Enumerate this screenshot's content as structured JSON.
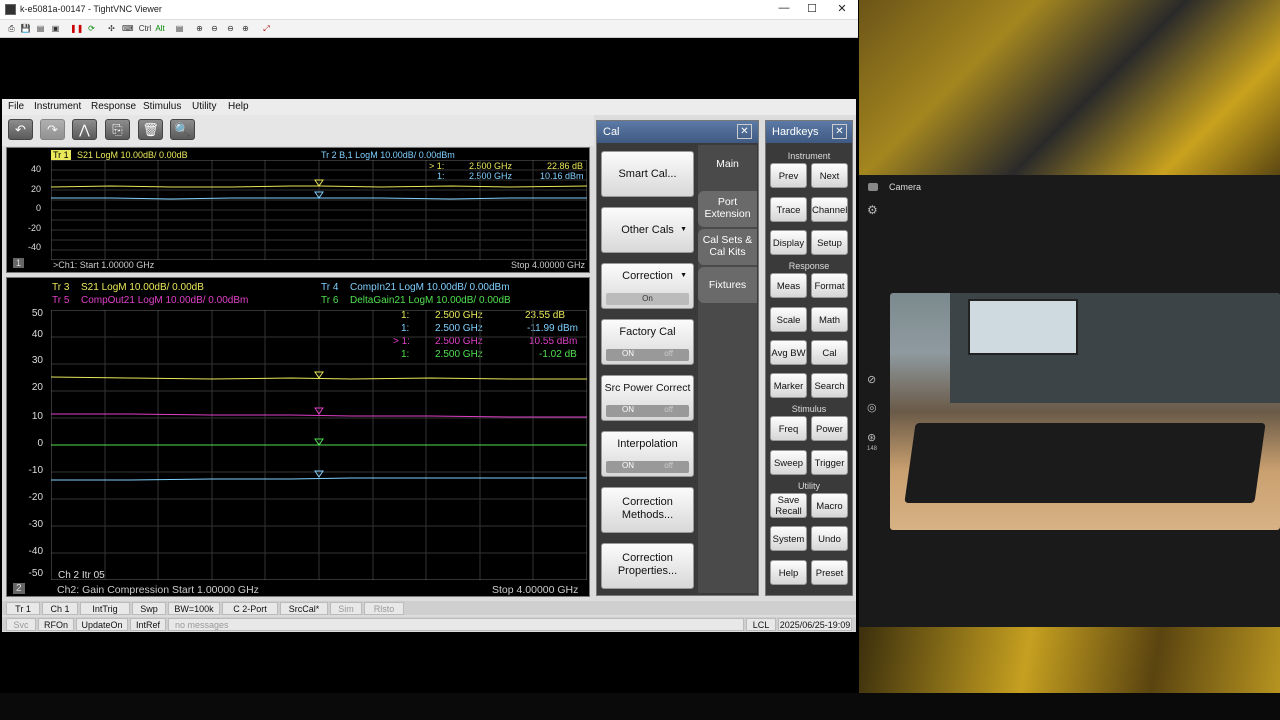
{
  "vnc": {
    "title": "k-e5081a-00147 - TightVNC Viewer",
    "minimize": "—",
    "maximize": "☐",
    "close": "✕",
    "toolbar_icons": [
      "⎙",
      "💾",
      "▤",
      "▣",
      "❚❚",
      "⟳",
      "✣",
      "⌨",
      "Ctrl",
      "Alt",
      "▤",
      "⊕",
      "⊖",
      "⊖",
      "⊕",
      "⤢"
    ]
  },
  "menu": [
    "File",
    "Instrument",
    "Response",
    "Stimulus",
    "Utility",
    "Help"
  ],
  "appbar_icons": [
    "↶",
    "↷",
    "⋀",
    "⎘",
    "🗑",
    "🔍"
  ],
  "window1": {
    "number": "1",
    "trace1": "S21 LogM 10.00dB/ 0.00dB",
    "trace1_id": "Tr 1",
    "trace2": "Tr 2  B,1 LogM 10.00dB/ 0.00dBm",
    "markers": [
      {
        "id": "> 1:",
        "freq": "2.500  GHz",
        "val": "22.86 dB",
        "color": "#e8e85a"
      },
      {
        "id": "1:",
        "freq": "2.500  GHz",
        "val": "10.16 dBm",
        "color": "#7fd0ff"
      }
    ],
    "yticks": [
      "40",
      "20",
      "0",
      "-20",
      "-40"
    ],
    "footer_left": ">Ch1: Start  1.00000 GHz",
    "footer_right": "Stop  4.00000 GHz"
  },
  "window2": {
    "number": "2",
    "traces": [
      {
        "id": "Tr 3",
        "label": "S21 LogM 10.00dB/ 0.00dB",
        "color": "#e8e85a"
      },
      {
        "id": "Tr 4",
        "label": "CompIn21 LogM 10.00dB/ 0.00dBm",
        "color": "#7fd0ff"
      },
      {
        "id": "Tr 5",
        "label": "CompOut21 LogM 10.00dB/ 0.00dBm",
        "color": "#e040c8"
      },
      {
        "id": "Tr 6",
        "label": "DeltaGain21 LogM 10.00dB/ 0.00dB",
        "color": "#50e050"
      }
    ],
    "markers": [
      {
        "id": "1:",
        "freq": "2.500  GHz",
        "val": "23.55 dB",
        "color": "#e8e85a"
      },
      {
        "id": "1:",
        "freq": "2.500  GHz",
        "val": "-11.99 dBm",
        "color": "#7fd0ff"
      },
      {
        "id": "> 1:",
        "freq": "2.500  GHz",
        "val": "10.55 dBm",
        "color": "#e040c8"
      },
      {
        "id": "1:",
        "freq": "2.500  GHz",
        "val": "-1.02 dB",
        "color": "#50e050"
      }
    ],
    "yticks": [
      "50",
      "40",
      "30",
      "20",
      "10",
      "0",
      "-10",
      "-20",
      "-30",
      "-40",
      "-50"
    ],
    "ch_info": "Ch 2  Itr 05",
    "footer_left": "Ch2: Gain Compression  Start  1.00000 GHz",
    "footer_right": "Stop  4.00000 GHz"
  },
  "status1": [
    "Tr 1",
    "Ch 1",
    "IntTrig",
    "Swp",
    "BW=100k",
    "C  2-Port",
    "SrcCal*",
    "Sim",
    "Rlsto"
  ],
  "status2": [
    "Svc",
    "RFOn",
    "UpdateOn",
    "IntRef",
    "no messages",
    "LCL",
    "2025/06/25-19:09"
  ],
  "cal": {
    "title": "Cal",
    "close": "✕",
    "buttons": [
      "Smart Cal...",
      "Other Cals",
      "Correction",
      "Factory Cal",
      "Src Power Correct",
      "Interpolation",
      "Correction Methods...",
      "Correction Properties..."
    ],
    "toggles": {
      "correction": "On",
      "factory": "ON",
      "src": "ON",
      "interp": "ON",
      "off": "off"
    },
    "tabs": [
      "Main",
      "Port Extension",
      "Cal Sets & Cal Kits",
      "Fixtures"
    ]
  },
  "hardkeys": {
    "title": "Hardkeys",
    "close": "✕",
    "sections": [
      "Instrument",
      "Response",
      "Stimulus",
      "Utility"
    ],
    "buttons": [
      "Prev",
      "Next",
      "Trace",
      "Channel",
      "Display",
      "Setup",
      "Meas",
      "Format",
      "Scale",
      "Math",
      "Avg BW",
      "Cal",
      "Marker",
      "Search",
      "Freq",
      "Power",
      "Sweep",
      "Trigger",
      "Save Recall",
      "Macro",
      "System",
      "Undo",
      "Help",
      "Preset"
    ]
  },
  "camera": {
    "label": "Camera",
    "count": "148"
  }
}
